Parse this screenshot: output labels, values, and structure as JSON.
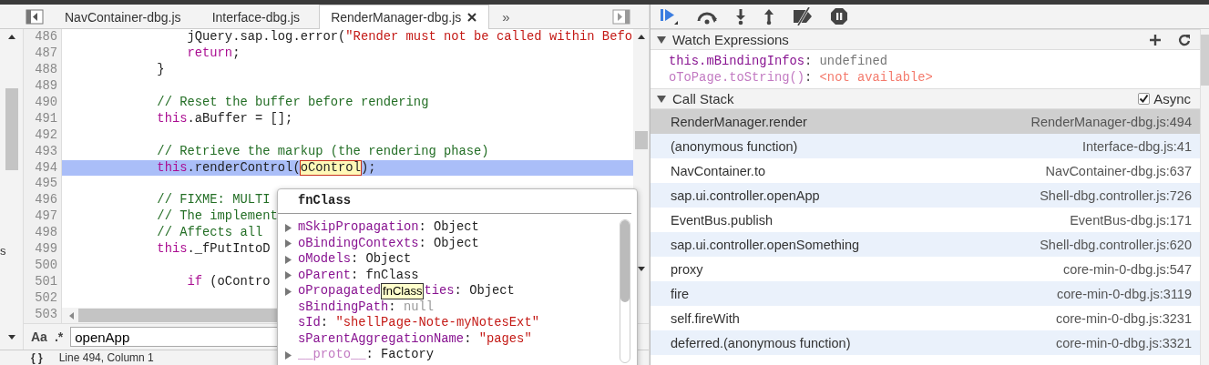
{
  "tabs": [
    {
      "label": "NavContainer-dbg.js",
      "selected": false
    },
    {
      "label": "Interface-dbg.js",
      "selected": false
    },
    {
      "label": "RenderManager-dbg.js",
      "selected": true
    }
  ],
  "tabs_overflow": "»",
  "left_edge_text": "s",
  "editor": {
    "lines": [
      {
        "number": "486",
        "selected": false,
        "tokens": [
          {
            "kind": "plain",
            "text": "                jQuery.sap.log.error("
          },
          {
            "kind": "string",
            "text": "\"Render must not be called within Befo"
          }
        ]
      },
      {
        "number": "487",
        "selected": false,
        "tokens": [
          {
            "kind": "keyword",
            "text": "                return"
          },
          {
            "kind": "plain",
            "text": ";"
          }
        ]
      },
      {
        "number": "488",
        "selected": false,
        "tokens": [
          {
            "kind": "plain",
            "text": "            }"
          }
        ]
      },
      {
        "number": "489",
        "selected": false
      },
      {
        "number": "490",
        "selected": false,
        "tokens": [
          {
            "kind": "comment",
            "text": "            // Reset the buffer before rendering"
          }
        ]
      },
      {
        "number": "491",
        "selected": false,
        "tokens": [
          {
            "kind": "keyword",
            "text": "            this"
          },
          {
            "kind": "plain",
            "text": ".aBuffer = [];"
          }
        ]
      },
      {
        "number": "492",
        "selected": false
      },
      {
        "number": "493",
        "selected": false,
        "tokens": [
          {
            "kind": "comment",
            "text": "            // Retrieve the markup (the rendering phase)"
          }
        ]
      },
      {
        "number": "494",
        "selected": true,
        "tokens": [
          {
            "kind": "keyword",
            "text": "            this"
          },
          {
            "kind": "plain",
            "text": ".renderControl("
          },
          {
            "kind": "hover",
            "text": "oControl"
          },
          {
            "kind": "plain",
            "text": ");"
          }
        ]
      },
      {
        "number": "495",
        "selected": false
      },
      {
        "number": "496",
        "selected": false,
        "tokens": [
          {
            "kind": "comment",
            "text": "            // FIXME: MULTI"
          }
        ]
      },
      {
        "number": "497",
        "selected": false,
        "tokens": [
          {
            "kind": "comment",
            "text": "            // The implement"
          }
        ]
      },
      {
        "number": "498",
        "selected": false,
        "tokens": [
          {
            "kind": "comment",
            "text": "            // Affects all"
          }
        ]
      },
      {
        "number": "499",
        "selected": false,
        "tokens": [
          {
            "kind": "keyword",
            "text": "            this"
          },
          {
            "kind": "plain",
            "text": "._fPutIntoD"
          }
        ]
      },
      {
        "number": "500",
        "selected": false
      },
      {
        "number": "501",
        "selected": false,
        "tokens": [
          {
            "kind": "keyword",
            "text": "                if"
          },
          {
            "kind": "plain",
            "text": " (oContro"
          }
        ]
      },
      {
        "number": "502",
        "selected": false
      },
      {
        "number": "503",
        "selected": false
      }
    ]
  },
  "popover": {
    "title": "fnClass",
    "properties": [
      {
        "name": "mSkipPropagation",
        "separator": ":",
        "value": "Object",
        "kind": "object",
        "expandable": true,
        "internal": false
      },
      {
        "name": "oBindingContexts",
        "separator": ":",
        "value": "Object",
        "kind": "object",
        "expandable": true,
        "internal": false
      },
      {
        "name": "oModels",
        "separator": ":",
        "value": "Object",
        "kind": "object",
        "expandable": true,
        "internal": false
      },
      {
        "name": "oParent",
        "separator": ":",
        "value": "fnClass",
        "kind": "object",
        "expandable": true,
        "internal": false
      },
      {
        "name": "oPropagated",
        "tooltip": "fnClass",
        "name_rest": "ties",
        "separator": ":",
        "value": "Object",
        "kind": "object",
        "expandable": true,
        "internal": false
      },
      {
        "name": "sBindingPath",
        "separator": ":",
        "value": "null",
        "kind": "null",
        "expandable": false,
        "internal": false
      },
      {
        "name": "sId",
        "separator": ":",
        "value": "\"shellPage-Note-myNotesExt\"",
        "kind": "string",
        "expandable": false,
        "internal": false
      },
      {
        "name": "sParentAggregationName",
        "separator": ":",
        "value": "\"pages\"",
        "kind": "string",
        "expandable": false,
        "internal": false
      },
      {
        "name": "__proto__",
        "separator": ":",
        "value": "Factory",
        "kind": "object",
        "expandable": true,
        "internal": true
      }
    ]
  },
  "search": {
    "case_toggle": "Aa",
    "regex_toggle": ".*",
    "value": "openApp"
  },
  "status_bar": {
    "format_toggle": "{ }",
    "position": "Line 494, Column 1"
  },
  "watch": {
    "title": "Watch Expressions",
    "expanded": true,
    "items": [
      {
        "expression": "this.mBindingInfos",
        "separator": ":",
        "value": "undefined",
        "available": true
      },
      {
        "expression": "oToPage.toString()",
        "separator": ":",
        "value": "<not available>",
        "available": false
      }
    ]
  },
  "call_stack": {
    "title": "Call Stack",
    "expanded": true,
    "async_label": "Async",
    "async_checked": true,
    "frames": [
      {
        "name": "RenderManager.render",
        "location": "RenderManager-dbg.js:494",
        "selected": true
      },
      {
        "name": "(anonymous function)",
        "location": "Interface-dbg.js:41",
        "selected": false
      },
      {
        "name": "NavContainer.to",
        "location": "NavContainer-dbg.js:637",
        "selected": false
      },
      {
        "name": "sap.ui.controller.openApp",
        "location": "Shell-dbg.controller.js:726",
        "selected": false
      },
      {
        "name": "EventBus.publish",
        "location": "EventBus-dbg.js:171",
        "selected": false
      },
      {
        "name": "sap.ui.controller.openSomething",
        "location": "Shell-dbg.controller.js:620",
        "selected": false
      },
      {
        "name": "proxy",
        "location": "core-min-0-dbg.js:547",
        "selected": false
      },
      {
        "name": "fire",
        "location": "core-min-0-dbg.js:3119",
        "selected": false
      },
      {
        "name": "self.fireWith",
        "location": "core-min-0-dbg.js:3231",
        "selected": false
      },
      {
        "name": "deferred.(anonymous function)",
        "location": "core-min-0-dbg.js:3321",
        "selected": false
      }
    ]
  }
}
